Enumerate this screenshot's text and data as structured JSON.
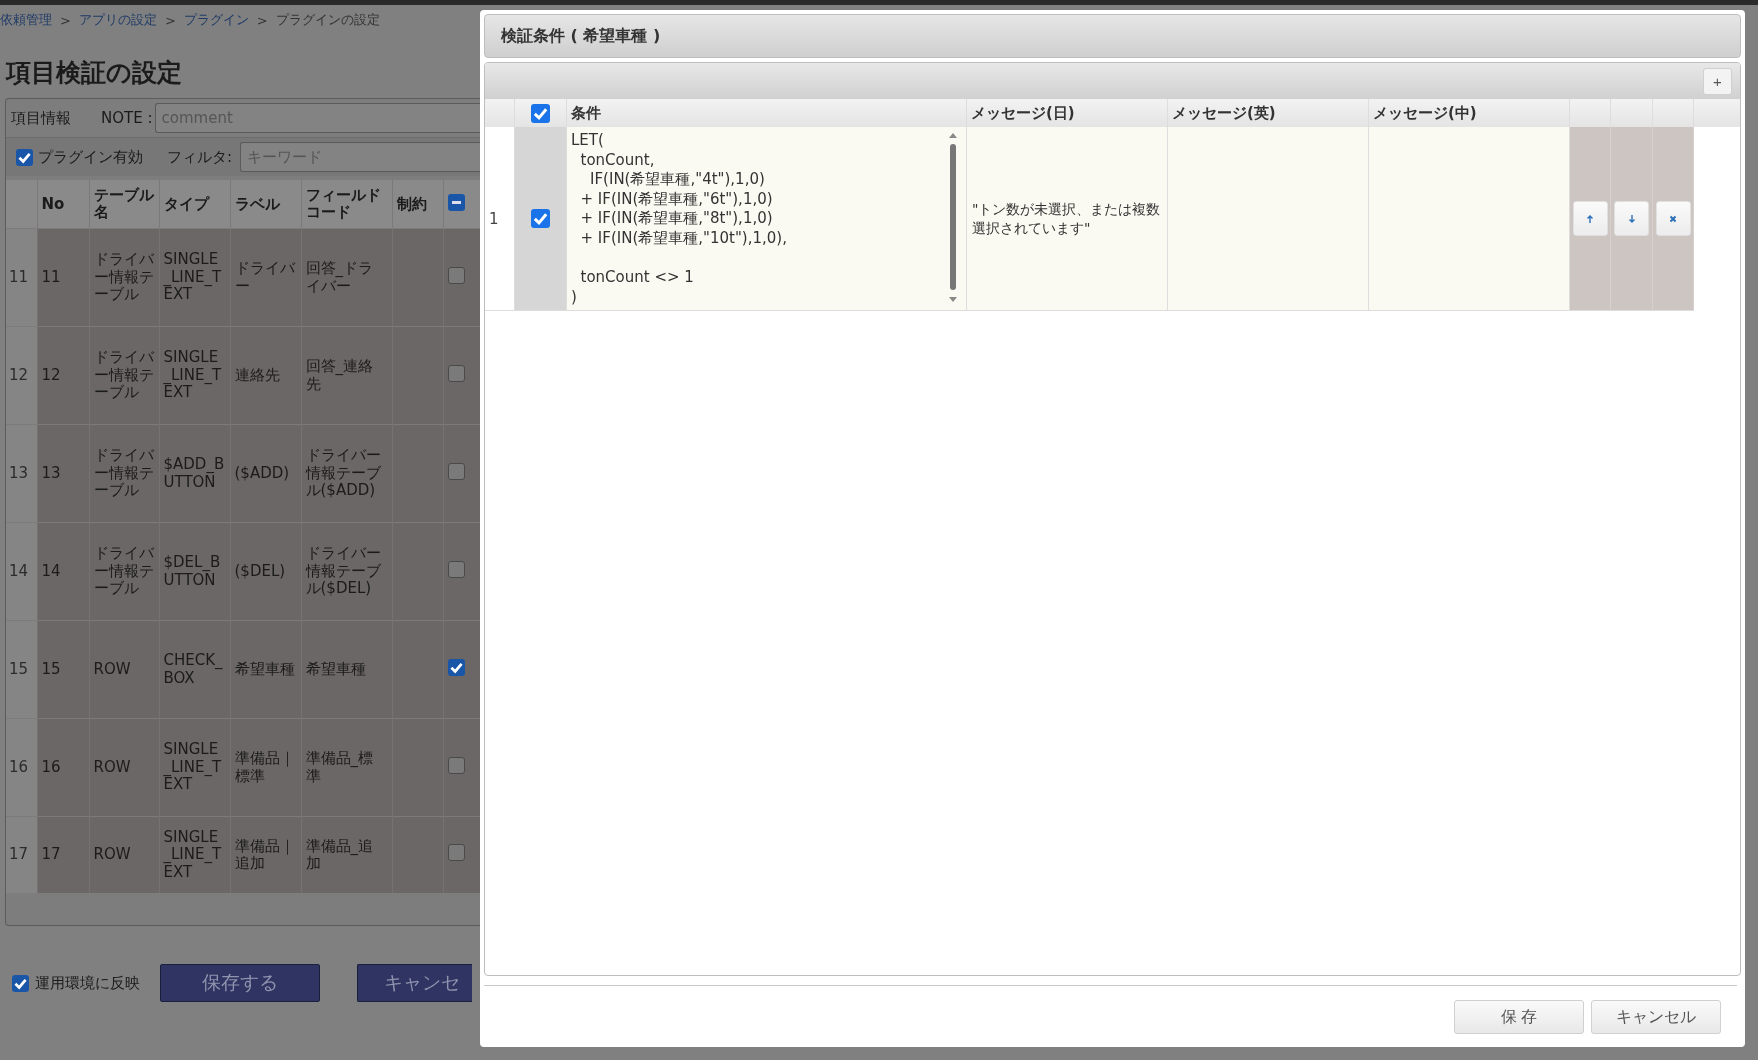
{
  "breadcrumb": {
    "separator": ">",
    "items": [
      {
        "label": "依頼管理",
        "link": true
      },
      {
        "label": "アプリの設定",
        "link": true
      },
      {
        "label": "プラグイン",
        "link": true
      },
      {
        "label": "プラグインの設定",
        "link": false
      }
    ]
  },
  "page_title": "項目検証の設定",
  "item_info": {
    "label": "項目情報",
    "note_label": "NOTE :",
    "placeholder": "comment"
  },
  "plugin_enabled": {
    "label": "プラグイン有効",
    "checked": true
  },
  "filter": {
    "label": "フィルタ:",
    "placeholder": "キーワード"
  },
  "table": {
    "columns": [
      "No",
      "テーブル名",
      "タイプ",
      "ラベル",
      "フィールドコード",
      "制約"
    ],
    "header_indeterminate": true,
    "rows": [
      {
        "index": "11",
        "no": "11",
        "table": "ドライバー情報テーブル",
        "type": "SINGLE_LINE_TEXT",
        "label": "ドライバー",
        "field_code": "回答_ドライバー",
        "checked": false
      },
      {
        "index": "12",
        "no": "12",
        "table": "ドライバー情報テーブル",
        "type": "SINGLE_LINE_TEXT",
        "label": "連絡先",
        "field_code": "回答_連絡先",
        "checked": false
      },
      {
        "index": "13",
        "no": "13",
        "table": "ドライバー情報テーブル",
        "type": "$ADD_BUTTON",
        "label": "($ADD)",
        "field_code": "ドライバー情報テーブル($ADD)",
        "checked": false
      },
      {
        "index": "14",
        "no": "14",
        "table": "ドライバー情報テーブル",
        "type": "$DEL_BUTTON",
        "label": "($DEL)",
        "field_code": "ドライバー情報テーブル($DEL)",
        "checked": false
      },
      {
        "index": "15",
        "no": "15",
        "table": "ROW",
        "type": "CHECK_BOX",
        "label": "希望車種",
        "field_code": "希望車種",
        "checked": true
      },
      {
        "index": "16",
        "no": "16",
        "table": "ROW",
        "type": "SINGLE_LINE_TEXT",
        "label": "準備品｜標準",
        "field_code": "準備品_標準",
        "checked": false
      },
      {
        "index": "17",
        "no": "17",
        "table": "ROW",
        "type": "SINGLE_LINE_TEXT",
        "label": "準備品｜追加",
        "field_code": "準備品_追加",
        "checked": false
      }
    ]
  },
  "deploy": {
    "label": "運用環境に反映",
    "checked": true
  },
  "buttons": [
    "保存する",
    "キャンセ"
  ],
  "modal": {
    "title": "検証条件 ( 希望車種 )",
    "add_button": "+",
    "header_checked": true,
    "columns": [
      "条件",
      "メッセージ(日)",
      "メッセージ(英)",
      "メッセージ(中)"
    ],
    "rows": [
      {
        "index": "1",
        "checked": true,
        "condition": "LET(\n  tonCount,\n    IF(IN(希望車種,\"4t\"),1,0)\n  + IF(IN(希望車種,\"6t\"),1,0)\n  + IF(IN(希望車種,\"8t\"),1,0)\n  + IF(IN(希望車種,\"10t\"),1,0),\n\n  tonCount <> 1\n)",
        "message_ja": "\"トン数が未選択、または複数選択されています\""
      }
    ],
    "buttons": [
      "保 存",
      "キャンセル"
    ]
  }
}
